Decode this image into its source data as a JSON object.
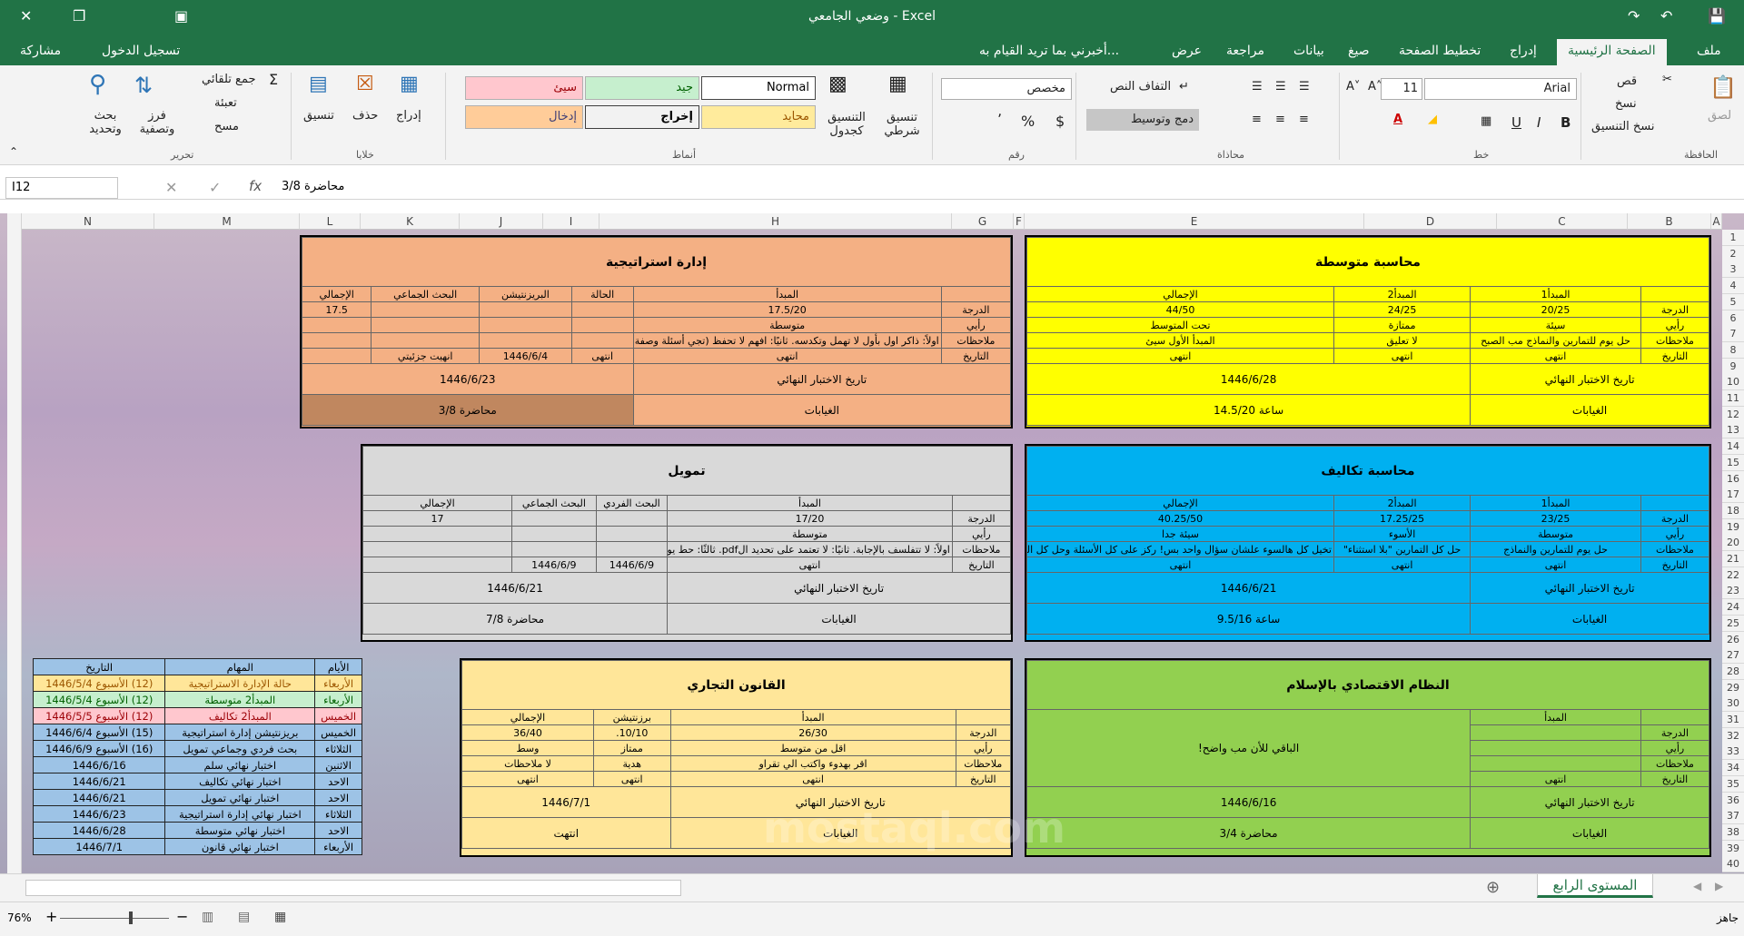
{
  "window": {
    "title": "وضعي الجامعي - Excel"
  },
  "menu": {
    "file": "ملف",
    "home": "الصفحة الرئيسية",
    "insert": "إدراج",
    "page_layout": "تخطيط الصفحة",
    "formulas": "صيغ",
    "data": "بيانات",
    "review": "مراجعة",
    "view": "عرض",
    "tell_me": "أخبرني بما تريد القيام به...",
    "sign_in": "تسجيل الدخول",
    "share": "مشاركة"
  },
  "ribbon": {
    "clipboard": {
      "paste": "لصق",
      "cut": "قص",
      "copy": "نسخ",
      "format_painter": "نسخ التنسيق",
      "label": "الحافظة"
    },
    "font": {
      "name": "Arial",
      "size": "11",
      "bold": "B",
      "italic": "I",
      "underline": "U",
      "label": "خط"
    },
    "alignment": {
      "wrap": "التفاف النص",
      "merge": "دمج وتوسيط",
      "label": "محاذاة"
    },
    "number": {
      "format": "مخصص",
      "currency": "$",
      "percent": "%",
      "comma": "٬",
      "label": "رقم"
    },
    "styles": {
      "conditional": "تنسيق شرطي",
      "table": "التنسيق كجدول",
      "normal": "Normal",
      "bad": "سيئ",
      "good": "جيد",
      "neutral": "محايد",
      "output": "إخراج",
      "input": "إدخال",
      "label": "أنماط"
    },
    "cells": {
      "insert": "إدراج",
      "delete": "حذف",
      "format": "تنسيق",
      "label": "خلايا"
    },
    "editing": {
      "autosum": "جمع تلقائي",
      "fill": "تعبئة",
      "clear": "مسح",
      "sort": "فرز وتصفية",
      "find": "بحث وتحديد",
      "label": "تحرير"
    }
  },
  "formula_bar": {
    "name_box": "I12",
    "formula": "محاضرة 3/8",
    "fx": "fx"
  },
  "columns": [
    "A",
    "B",
    "C",
    "D",
    "E",
    "F",
    "G",
    "H",
    "I",
    "J",
    "K",
    "L",
    "M",
    "N"
  ],
  "rows": [
    "1",
    "2",
    "3",
    "4",
    "5",
    "6",
    "7",
    "8",
    "9",
    "10",
    "11",
    "12",
    "13",
    "14",
    "15",
    "16",
    "17",
    "18",
    "19",
    "20",
    "21",
    "22",
    "23",
    "24",
    "25",
    "26",
    "27",
    "28",
    "29",
    "30",
    "31",
    "32",
    "33",
    "34",
    "35",
    "36",
    "37",
    "38",
    "39",
    "40"
  ],
  "blocks": {
    "avg_acc": {
      "title": "محاسبة متوسطة",
      "color": "#ffff00",
      "h": [
        "",
        "المبدأ1",
        "المبدأ2",
        "الإجمالي"
      ],
      "r1": [
        "الدرجة",
        "20/25",
        "24/25",
        "44/50"
      ],
      "r2": [
        "رأيي",
        "سيئة",
        "ممتازة",
        "تحت المتوسط"
      ],
      "r3": [
        "ملاحظات",
        "حل يوم للتمارين والنماذج مب الصبح",
        "لا تعليق",
        "المبدأ الأول سيئ"
      ],
      "r4": [
        "التاريخ",
        "انتهى",
        "انتهى",
        "انتهى"
      ],
      "final_label": "تاريخ الاختبار النهائي",
      "final": "1446/6/28",
      "abs_label": "الغيابات",
      "abs": "ساعة 14.5/20"
    },
    "strategy": {
      "title": "إدارة استراتيجية",
      "color": "#f4b084",
      "h": [
        "",
        "المبدأ",
        "الحالة",
        "البريزنتيشن",
        "البحث الجماعي",
        "الإجمالي"
      ],
      "r1": [
        "الدرجة",
        "17.5/20",
        "",
        "",
        "",
        "17.5"
      ],
      "r2": [
        "رأيي",
        "متوسطة",
        "",
        "",
        "",
        ""
      ],
      "r3": [
        "ملاحظات",
        "اولاً: ذاكر اول بأول لا تهمل وتكدسه. ثانيًا: افهم لا تحفظ (تجي أسئلة وصفة للفهم)",
        "",
        "",
        "",
        ""
      ],
      "r4": [
        "التاريخ",
        "انتهى",
        "انتهى",
        "1446/6/4",
        "انهيت جزئيتي",
        ""
      ],
      "final_label": "تاريخ الاختبار النهائي",
      "final": "1446/6/23",
      "abs_label": "الغيابات",
      "abs": "محاضرة 3/8"
    },
    "cost_acc": {
      "title": "محاسبة تكاليف",
      "color": "#00b0f0",
      "h": [
        "",
        "المبدأ1",
        "المبدأ2",
        "الإجمالي"
      ],
      "r1": [
        "الدرجة",
        "23/25",
        "17.25/25",
        "40.25/50"
      ],
      "r2": [
        "رأيي",
        "متوسطة",
        "الأسوء",
        "سيئة جدا"
      ],
      "r3": [
        "ملاحظات",
        "حل يوم للتمارين والنماذج",
        "حل كل التمارين \"بلا استثناء\"",
        "تخيل كل هالسوء علشان سؤال واحد بس! ركز على كل الأسئلة وحل كل التمارين"
      ],
      "r4": [
        "التاريخ",
        "انتهى",
        "انتهى",
        "انتهى"
      ],
      "final_label": "تاريخ الاختبار النهائي",
      "final": "1446/6/21",
      "abs_label": "الغيابات",
      "abs": "ساعة 9.5/16"
    },
    "finance": {
      "title": "تمويل",
      "color": "#d9d9d9",
      "h": [
        "",
        "المبدأ",
        "البحث الفردي",
        "البحث الجماعي",
        "الإجمالي"
      ],
      "r1": [
        "الدرجة",
        "17/20",
        "",
        "",
        "17"
      ],
      "r2": [
        "رأيي",
        "متوسطة",
        "",
        "",
        ""
      ],
      "r3": [
        "ملاحظات",
        "اولاً: لا تتفلسف بالإجابة. ثانيًا: لا تعتمد على تحديد الpdf. ثالثًا: حط يوم للتمارين",
        "",
        "",
        ""
      ],
      "r4": [
        "التاريخ",
        "انتهى",
        "1446/6/9",
        "1446/6/9",
        ""
      ],
      "final_label": "تاريخ الاختبار النهائي",
      "final": "1446/6/21",
      "abs_label": "الغيابات",
      "abs": "محاضرة 7/8"
    },
    "islamic": {
      "title": "النظام الاقتصادي بالإسلام",
      "color": "#92d050",
      "h": [
        "",
        "المبدأ"
      ],
      "rows": [
        "الدرجة",
        "رأيي",
        "ملاحظات",
        "التاريخ"
      ],
      "last": "انتهى",
      "note": "الباقي للأن مب واضح!",
      "final_label": "تاريخ الاختبار النهائي",
      "final": "1446/6/16",
      "abs_label": "الغيابات",
      "abs": "محاضرة 3/4"
    },
    "law": {
      "title": "القانون التجاري",
      "color": "#ffe699",
      "h": [
        "",
        "المبدأ",
        "برزنتيشن",
        "الإجمالي"
      ],
      "r1": [
        "الدرجة",
        "26/30",
        "10/10.",
        "36/40"
      ],
      "r2": [
        "رأيي",
        "اقل من متوسط",
        "ممتاز",
        "وسط"
      ],
      "r3": [
        "ملاحظات",
        "اقر بهدوء واكتب الي تقراو",
        "هدية",
        "لا ملاحظات"
      ],
      "r4": [
        "التاريخ",
        "انتهى",
        "انتهى",
        "انتهى"
      ],
      "final_label": "تاريخ الاختبار النهائي",
      "final": "1446/7/1",
      "abs_label": "الغيابات",
      "abs": "انتهت"
    }
  },
  "schedule": {
    "headers": [
      "الأيام",
      "المهام",
      "التاريخ"
    ],
    "rows": [
      [
        "الأربعاء",
        "حالة الإدارة الاستراتيجية",
        "(12) الأسبوع 1446/5/4"
      ],
      [
        "الأربعاء",
        "المبدأ2 متوسطة",
        "(12) الأسبوع 1446/5/4"
      ],
      [
        "الخميس",
        "المبدأ2 تكاليف",
        "(12) الأسبوع 1446/5/5"
      ],
      [
        "الخميس",
        "بريزنتيشن إدارة استراتيجية",
        "(15) الأسبوع 1446/6/4"
      ],
      [
        "الثلاثاء",
        "بحث فردي وجماعي تمويل",
        "(16) الأسبوع 1446/6/9"
      ],
      [
        "الاثنين",
        "اختبار نهائي سلم",
        "1446/6/16"
      ],
      [
        "الاحد",
        "اختبار نهائي تكاليف",
        "1446/6/21"
      ],
      [
        "الاحد",
        "اختبار نهائي تمويل",
        "1446/6/21"
      ],
      [
        "الثلاثاء",
        "اختبار نهائي إدارة استراتيجية",
        "1446/6/23"
      ],
      [
        "الاحد",
        "اختبار نهائي متوسطة",
        "1446/6/28"
      ],
      [
        "الأربعاء",
        "اختبار نهائي قانون",
        "1446/7/1"
      ]
    ]
  },
  "sheet_tab": "المستوى الرابع",
  "status": {
    "ready": "جاهز",
    "zoom": "76%"
  },
  "watermark": "mostaql.com"
}
